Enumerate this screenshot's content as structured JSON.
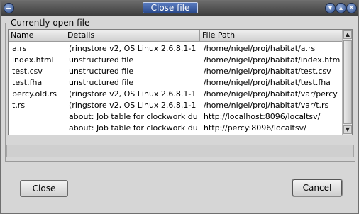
{
  "window": {
    "title": "Close file"
  },
  "group": {
    "label": "Currently open file"
  },
  "table": {
    "headers": [
      "Name",
      "Details",
      "File Path"
    ],
    "rows": [
      {
        "name": "a.rs",
        "details": "(ringstore v2, OS Linux 2.6.8.1-1",
        "path": "/home/nigel/proj/habitat/a.rs"
      },
      {
        "name": "index.html",
        "details": "unstructured file",
        "path": "/home/nigel/proj/habitat/index.htm"
      },
      {
        "name": "test.csv",
        "details": "unstructured file",
        "path": "/home/nigel/proj/habitat/test.csv"
      },
      {
        "name": "test.fha",
        "details": "unstructured file",
        "path": "/home/nigel/proj/habitat/test.fha"
      },
      {
        "name": "percy.old.rs",
        "details": "(ringstore v2, OS Linux 2.6.8.1-1",
        "path": "/home/nigel/proj/habitat/var/percy"
      },
      {
        "name": "t.rs",
        "details": "(ringstore v2, OS Linux 2.6.8.1-1",
        "path": "/home/nigel/proj/habitat/var/t.rs"
      },
      {
        "name": "",
        "details": "about: Job table for clockwork du",
        "path": "http://localhost:8096/localtsv/"
      },
      {
        "name": "",
        "details": "about: Job table for clockwork du",
        "path": "http://percy:8096/localtsv/"
      }
    ]
  },
  "buttons": {
    "close_label": "Close",
    "cancel_label": "Cancel"
  },
  "icons": {
    "window_menu": "window-menu-icon",
    "minimize": "minimize-icon",
    "maximize": "maximize-icon",
    "close": "close-icon",
    "scroll_up": "scroll-up-arrow-icon",
    "scroll_down": "scroll-down-arrow-icon"
  },
  "colors": {
    "title_accent": "#2a4a8c",
    "window_bg": "#d6d6d6",
    "table_bg": "#ffffff"
  }
}
